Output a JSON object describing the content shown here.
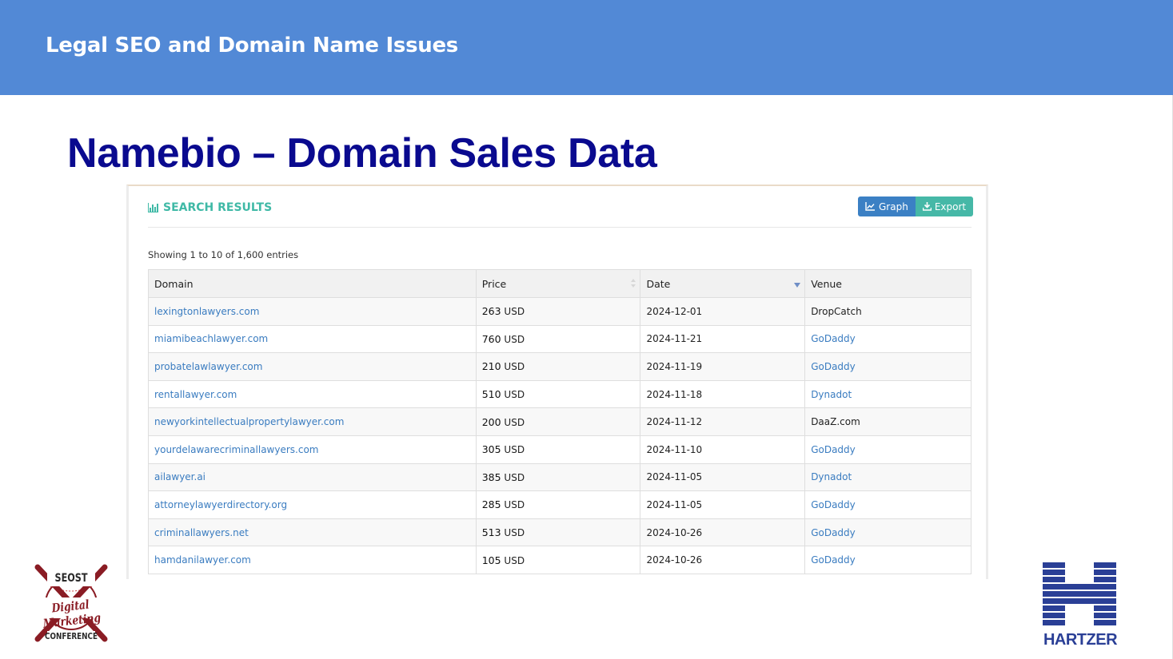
{
  "slide": {
    "header": "Legal SEO and Domain Name Issues",
    "title": "Namebio – Domain Sales Data"
  },
  "panel": {
    "heading": "SEARCH RESULTS",
    "graph_label": "Graph",
    "export_label": "Export",
    "showing": "Showing 1 to 10 of 1,600 entries"
  },
  "table": {
    "columns": [
      "Domain",
      "Price",
      "Date",
      "Venue"
    ],
    "rows": [
      {
        "domain": "lexingtonlawyers.com",
        "price": "263",
        "currency": "USD",
        "date": "2024-12-01",
        "venue": "DropCatch",
        "venue_link": false
      },
      {
        "domain": "miamibeachlawyer.com",
        "price": "760",
        "currency": "USD",
        "date": "2024-11-21",
        "venue": "GoDaddy",
        "venue_link": true
      },
      {
        "domain": "probatelawlawyer.com",
        "price": "210",
        "currency": "USD",
        "date": "2024-11-19",
        "venue": "GoDaddy",
        "venue_link": true
      },
      {
        "domain": "rentallawyer.com",
        "price": "510",
        "currency": "USD",
        "date": "2024-11-18",
        "venue": "Dynadot",
        "venue_link": true
      },
      {
        "domain": "newyorkintellectualpropertylawyer.com",
        "price": "200",
        "currency": "USD",
        "date": "2024-11-12",
        "venue": "DaaZ.com",
        "venue_link": false
      },
      {
        "domain": "yourdelawarecriminallawyers.com",
        "price": "305",
        "currency": "USD",
        "date": "2024-11-10",
        "venue": "GoDaddy",
        "venue_link": true
      },
      {
        "domain": "ailawyer.ai",
        "price": "385",
        "currency": "USD",
        "date": "2024-11-05",
        "venue": "Dynadot",
        "venue_link": true
      },
      {
        "domain": "attorneylawyerdirectory.org",
        "price": "285",
        "currency": "USD",
        "date": "2024-11-05",
        "venue": "GoDaddy",
        "venue_link": true
      },
      {
        "domain": "criminallawyers.net",
        "price": "513",
        "currency": "USD",
        "date": "2024-10-26",
        "venue": "GoDaddy",
        "venue_link": true
      },
      {
        "domain": "hamdanilawyer.com",
        "price": "105",
        "currency": "USD",
        "date": "2024-10-26",
        "venue": "GoDaddy",
        "venue_link": true
      }
    ]
  },
  "logos": {
    "left": {
      "top": "SEOST",
      "middle": "Digital Marketing",
      "bottom": "CONFERENCE"
    },
    "right": {
      "word": "HARTZER"
    }
  },
  "colors": {
    "header_bar": "#5289d6",
    "title": "#0a0a8f",
    "link": "#3a7cc0",
    "teal": "#3fb9a6",
    "hartzer_blue": "#2a3f96",
    "seost_red": "#8a1c24"
  }
}
